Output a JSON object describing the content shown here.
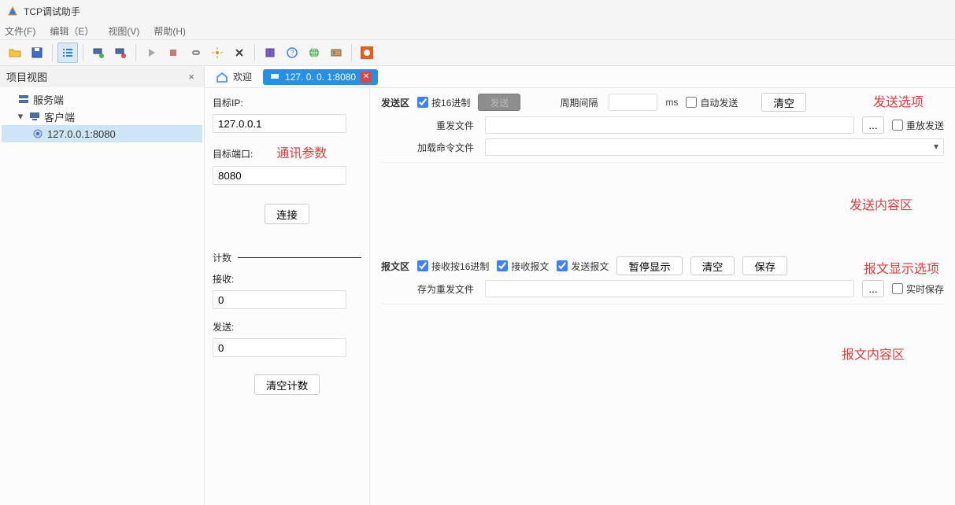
{
  "window": {
    "title": "TCP调试助手"
  },
  "menu": {
    "file": "文件(F)",
    "edit": "编辑（E）",
    "view": "视图(V)",
    "help": "帮助(H)"
  },
  "sidebar": {
    "title": "项目视图",
    "close": "×",
    "server_node": "服务端",
    "client_node": "客户端",
    "connection_node": "127.0.0.1:8080"
  },
  "tabs": {
    "welcome": "欢迎",
    "conn": "127. 0. 0. 1:8080"
  },
  "left": {
    "target_ip_label": "目标IP:",
    "target_ip_value": "127.0.0.1",
    "target_port_label": "目标端口:",
    "target_port_value": "8080",
    "connect_btn": "连接",
    "count_label": "计数",
    "recv_label": "接收:",
    "recv_value": "0",
    "send_label": "发送:",
    "send_value": "0",
    "clear_count_btn": "清空计数"
  },
  "send": {
    "section": "发送区",
    "hex": "按16进制",
    "send_btn": "发送",
    "interval_label": "周期间隔",
    "interval_unit": "ms",
    "auto_send": "自动发送",
    "clear_btn": "清空",
    "resend_file_label": "重发文件",
    "browse": "...",
    "replay_send": "重放发送",
    "load_cmd_label": "加载命令文件"
  },
  "msg": {
    "section": "报文区",
    "recv_hex": "接收按16进制",
    "recv_msg": "接收报文",
    "send_msg": "发送报文",
    "pause_btn": "暂停显示",
    "clear_btn": "清空",
    "save_btn": "保存",
    "save_as_label": "存为重发文件",
    "realtime_save": "实时保存"
  },
  "annotations": {
    "comm_params": "通讯参数",
    "send_opts": "发送选项",
    "send_area": "发送内容区",
    "msg_opts": "报文显示选项",
    "msg_area": "报文内容区"
  }
}
